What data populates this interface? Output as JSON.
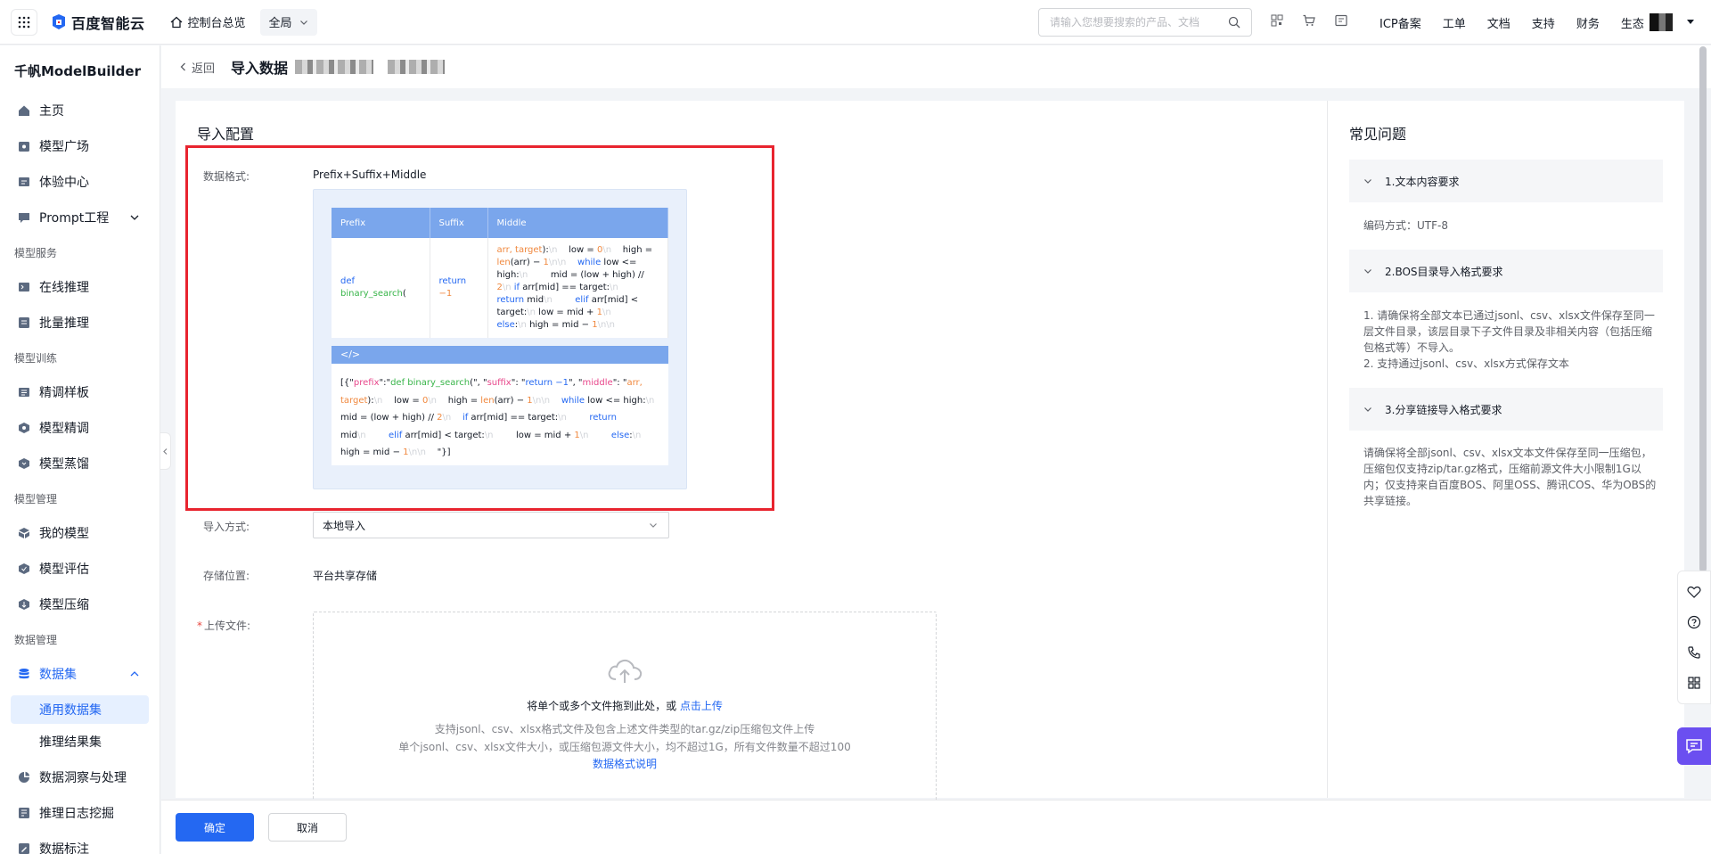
{
  "topbar": {
    "logo_text": "百度智能云",
    "console_home": "控制台总览",
    "region": "全局",
    "search_placeholder": "请输入您想要搜索的产品、文档",
    "links": [
      "ICP备案",
      "工单",
      "文档",
      "支持",
      "财务",
      "生态"
    ]
  },
  "sidebar": {
    "title": "千帆ModelBuilder",
    "items_top": [
      {
        "label": "主页",
        "icon": "home-icon"
      },
      {
        "label": "模型广场",
        "icon": "model-square-icon"
      },
      {
        "label": "体验中心",
        "icon": "experience-icon"
      },
      {
        "label": "Prompt工程",
        "icon": "prompt-icon"
      }
    ],
    "group_service": "模型服务",
    "items_service": [
      {
        "label": "在线推理",
        "icon": "online-inference-icon"
      },
      {
        "label": "批量推理",
        "icon": "batch-inference-icon"
      }
    ],
    "group_training": "模型训练",
    "items_training": [
      {
        "label": "精调样板",
        "icon": "template-icon"
      },
      {
        "label": "模型精调",
        "icon": "finetune-icon"
      },
      {
        "label": "模型蒸馏",
        "icon": "distill-icon"
      }
    ],
    "group_manage": "模型管理",
    "items_manage": [
      {
        "label": "我的模型",
        "icon": "my-model-icon"
      },
      {
        "label": "模型评估",
        "icon": "evaluate-icon"
      },
      {
        "label": "模型压缩",
        "icon": "compress-icon"
      }
    ],
    "group_data": "数据管理",
    "dataset": "数据集",
    "dataset_subs": [
      "通用数据集",
      "推理结果集"
    ],
    "items_data": [
      {
        "label": "数据洞察与处理",
        "icon": "insight-icon"
      },
      {
        "label": "推理日志挖掘",
        "icon": "log-mining-icon"
      },
      {
        "label": "数据标注",
        "icon": "annotation-icon"
      }
    ]
  },
  "header": {
    "back": "返回",
    "title": "导入数据"
  },
  "form": {
    "section_title": "导入配置",
    "format_label": "数据格式:",
    "format_value": "Prefix+Suffix+Middle",
    "table_headers": [
      "Prefix",
      "Suffix",
      "Middle"
    ],
    "code_tag": "</>",
    "import_label": "导入方式:",
    "import_value": "本地导入",
    "storage_label": "存储位置:",
    "storage_value": "平台共享存储",
    "upload_label": "上传文件:",
    "upload_main": "将单个或多个文件拖到此处，或",
    "upload_link": "点击上传",
    "upload_hint1": "支持jsonl、csv、xlsx格式文件及包含上述文件类型的tar.gz/zip压缩包文件上传",
    "upload_hint2": "单个jsonl、csv、xlsx文件大小，或压缩包源文件大小，均不超过1G，所有文件数量不超过100",
    "upload_doc": "数据格式说明"
  },
  "faq": {
    "title": "常见问题",
    "q1": "1.文本内容要求",
    "a1": "编码方式：UTF-8",
    "q2": "2.BOS目录导入格式要求",
    "a2_1": "1. 请确保将全部文本已通过jsonl、csv、xlsx文件保存至同一层文件目录，该层目录下子文件目录及非相关内容（包括压缩包格式等）不导入。",
    "a2_2": "2. 支持通过jsonl、csv、xlsx方式保存文本",
    "q3": "3.分享链接导入格式要求",
    "a3": "请确保将全部jsonl、csv、xlsx文本文件保存至同一压缩包，压缩包仅支持zip/tar.gz格式，压缩前源文件大小限制1G以内；仅支持来自百度BOS、阿里OSS、腾讯COS、华为OBS的共享链接。"
  },
  "footer": {
    "confirm": "确定",
    "cancel": "取消"
  },
  "colors": {
    "accent": "#2468f2",
    "highlight": "#e8242f",
    "chat": "#6b4ff0"
  }
}
